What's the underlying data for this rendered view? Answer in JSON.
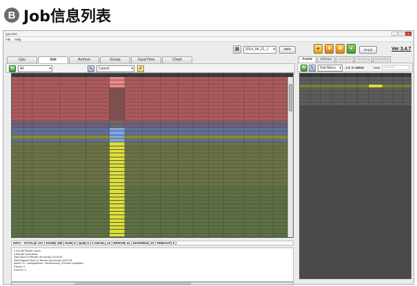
{
  "page": {
    "badge": "B",
    "title": "Job信息列表"
  },
  "window": {
    "title": "ygr.solui",
    "menu": [
      "File",
      "Help"
    ],
    "controls": {
      "min": "_",
      "max": "□",
      "close": "x"
    }
  },
  "toolbar": {
    "date": "2014_04_21_1",
    "hello_label": "hello",
    "cb_label": "cb-job",
    "version": "Ver 3.4.7",
    "icons": [
      "folder-icon",
      "box-icon",
      "box-icon",
      "globe-icon"
    ]
  },
  "left": {
    "tabs": [
      "Cpu",
      "Job",
      "Archive",
      "Group",
      "CpusTime",
      "Chart"
    ],
    "active_tab": "Job",
    "filter1": "All",
    "filter2": "Cancel",
    "info": "INFO : TOTAL(E 107 ) DONE( 388 ) RUN( 6 ) QUE( 6 ) CANCEL( 10 ) ERROR( 41 ) WARNING( 10 ) TIMEOUT( 0 )",
    "log_lines": [
      "0.014 Mb    Render Cache",
      "0.059 Mb    Chart Areas",
      "",
      "Total Time For Render (hh:mm:ss): 00:00:26",
      "Total Elapsed Time For Render (hh:mm:ss): 00:01:26",
      "Scene: D:\\...\\temp\\scenes\\...\\render\\scene_014.max  completed",
      "Frames: 0",
      "STATUS: 0"
    ]
  },
  "right": {
    "tabs": [
      "Frame",
      "InfoCpu",
      "HeadJob",
      "HeadLog",
      "JobsOther"
    ],
    "active_tab": "Frame",
    "menu": "Sub Menu",
    "job_id_label": "Job ID",
    "job_id": "43619",
    "user_label": "User",
    "user_value": "renderfarm"
  },
  "colors": {
    "red_row": "#a95a5a",
    "purple_row": "#6f5f7e",
    "blue_row": "#5f6f93",
    "olive_row": "#6a7146",
    "green_row": "#5c6f45",
    "yellow_status": "#dede3a",
    "pink_status": "#e58a8a",
    "blue_status": "#7fa4e0",
    "highlight": "#8a8a2a"
  }
}
